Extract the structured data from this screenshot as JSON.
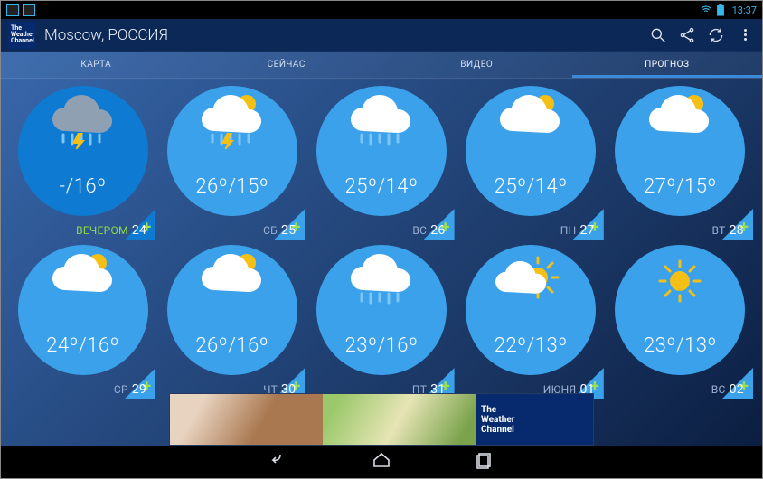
{
  "status": {
    "time": "13:37"
  },
  "appbar": {
    "logo_lines": [
      "The",
      "Weather",
      "Channel"
    ],
    "location": "Moscow, РОССИЯ"
  },
  "tabs": [
    {
      "label": "КАРТА"
    },
    {
      "label": "СЕЙЧАС"
    },
    {
      "label": "ВИДЕО"
    },
    {
      "label": "ПРОГНОЗ"
    }
  ],
  "forecast": [
    {
      "icon": "thunder-rain-cloud",
      "hi": "-",
      "lo": "16",
      "day": "ВЕЧЕРОМ",
      "num": "24",
      "selected": true,
      "active_label": true
    },
    {
      "icon": "rain-sun-cloud",
      "hi": "26",
      "lo": "15",
      "day": "СБ",
      "num": "25",
      "selected": false,
      "active_label": false
    },
    {
      "icon": "rain-cloud",
      "hi": "25",
      "lo": "14",
      "day": "ВС",
      "num": "26",
      "selected": false,
      "active_label": false
    },
    {
      "icon": "sun-cloud",
      "hi": "25",
      "lo": "14",
      "day": "ПН",
      "num": "27",
      "selected": false,
      "active_label": false
    },
    {
      "icon": "sun-cloud",
      "hi": "27",
      "lo": "15",
      "day": "ВТ",
      "num": "28",
      "selected": false,
      "active_label": false
    },
    {
      "icon": "sun-cloud",
      "hi": "24",
      "lo": "16",
      "day": "СР",
      "num": "29",
      "selected": false,
      "active_label": false
    },
    {
      "icon": "sun-cloud",
      "hi": "26",
      "lo": "16",
      "day": "ЧТ",
      "num": "30",
      "selected": false,
      "active_label": false
    },
    {
      "icon": "rain-cloud",
      "hi": "23",
      "lo": "16",
      "day": "ПТ",
      "num": "31",
      "selected": false,
      "active_label": false
    },
    {
      "icon": "partly-sunny",
      "hi": "22",
      "lo": "13",
      "day": "ИЮНЯ",
      "num": "01",
      "selected": false,
      "active_label": false
    },
    {
      "icon": "sunny",
      "hi": "23",
      "lo": "13",
      "day": "ВС",
      "num": "02",
      "selected": false,
      "active_label": false
    }
  ],
  "ad": {
    "brand_lines": [
      "The",
      "Weather",
      "Channel"
    ]
  }
}
